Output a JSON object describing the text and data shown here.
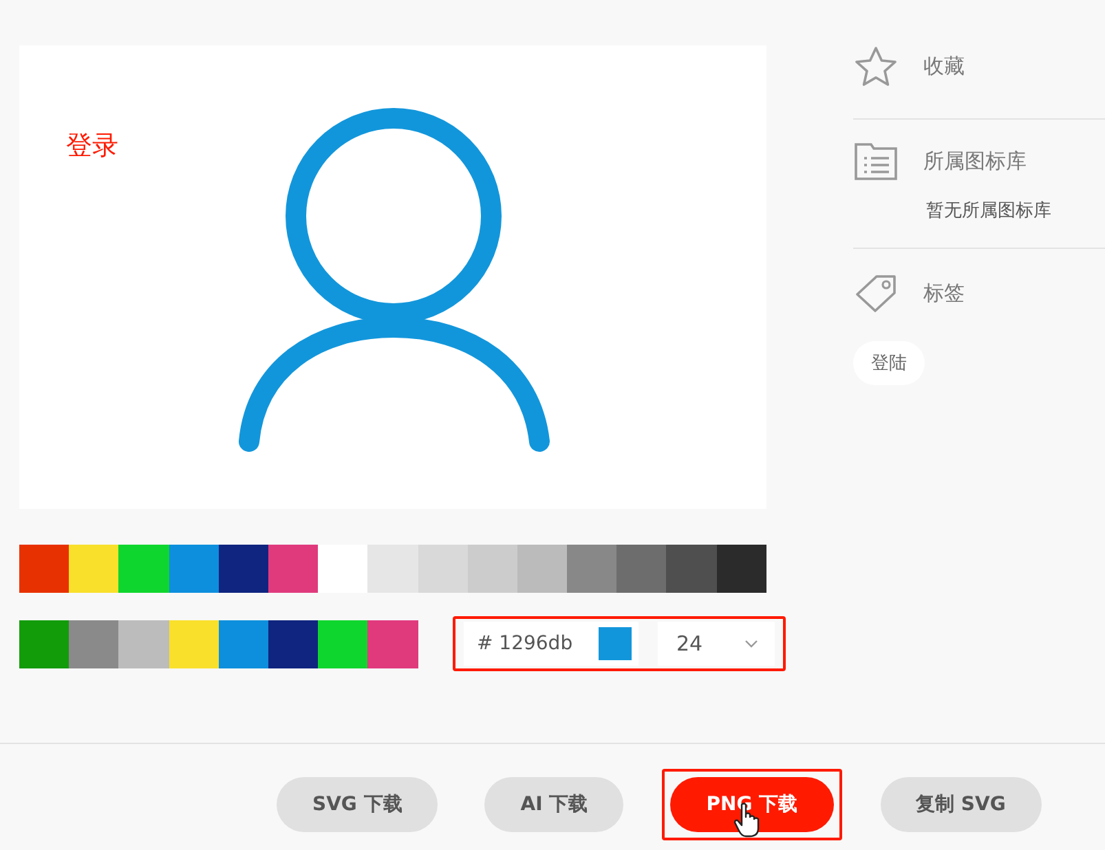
{
  "preview": {
    "annotation": "登录"
  },
  "swatch_rows": [
    {
      "swatches": [
        {
          "color": "#e83100"
        },
        {
          "color": "#f9e02b"
        },
        {
          "color": "#0fd62e"
        },
        {
          "color": "#0d8fdd"
        },
        {
          "color": "#102580"
        },
        {
          "color": "#e03a7d"
        },
        {
          "color": "#ffffff"
        },
        {
          "color": "#e6e6e6"
        },
        {
          "color": "#d9d9d9"
        },
        {
          "color": "#cccccc"
        },
        {
          "color": "#bbbbbb"
        },
        {
          "color": "#888888"
        },
        {
          "color": "#6d6d6d"
        },
        {
          "color": "#4f4f4f"
        },
        {
          "color": "#2b2b2b"
        }
      ]
    },
    {
      "swatches": [
        {
          "color": "#129c0a"
        },
        {
          "color": "#8a8a8a"
        },
        {
          "color": "#bcbcbc"
        },
        {
          "color": "#f9e02b"
        },
        {
          "color": "#0d8fdd"
        },
        {
          "color": "#102580"
        },
        {
          "color": "#0fd62e"
        },
        {
          "color": "#e03a7d"
        }
      ]
    }
  ],
  "color_picker": {
    "value": "# 1296db",
    "color": "#1296db",
    "size": "24",
    "highlighted": true
  },
  "buttons": [
    {
      "label": "SVG 下载",
      "kind": "default",
      "highlighted": false,
      "cursor": false
    },
    {
      "label": "AI 下载",
      "kind": "default",
      "highlighted": false,
      "cursor": false
    },
    {
      "label": "PNG 下载",
      "kind": "primary",
      "highlighted": true,
      "cursor": true
    },
    {
      "label": "复制 SVG",
      "kind": "default",
      "highlighted": false,
      "cursor": false
    }
  ],
  "sidebar": {
    "favorite": {
      "label": "收藏"
    },
    "library": {
      "label": "所属图标库",
      "value": "暂无所属图标库"
    },
    "tags": {
      "label": "标签",
      "items": [
        "登陆"
      ]
    }
  }
}
